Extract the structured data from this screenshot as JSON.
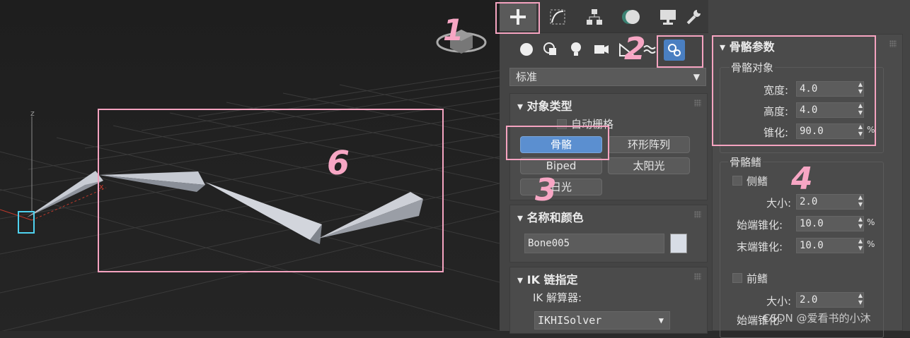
{
  "viewport": {
    "axis_z": "z",
    "axis_x": "x"
  },
  "tabs": [
    {
      "name": "create",
      "icon": "plus-icon"
    },
    {
      "name": "modify",
      "icon": "modify-curve-icon"
    },
    {
      "name": "hierarchy",
      "icon": "hierarchy-icon"
    },
    {
      "name": "motion",
      "icon": "motion-icon"
    },
    {
      "name": "display",
      "icon": "display-icon"
    },
    {
      "name": "utilities",
      "icon": "wrench-icon"
    }
  ],
  "tools": [
    "geometry-icon",
    "shapes-icon",
    "lights-icon",
    "cameras-icon",
    "helpers-icon",
    "spacewarps-icon",
    "systems-icon"
  ],
  "dropdown": {
    "value": "标准"
  },
  "object_type": {
    "title": "对象类型",
    "autogrid": "自动栅格",
    "buttons": [
      "骨骼",
      "环形阵列",
      "Biped",
      "太阳光",
      "日光"
    ]
  },
  "name_color": {
    "title": "名称和颜色",
    "name_value": "Bone005",
    "swatch": "#d8dde6"
  },
  "ik": {
    "title": "IK 链指定",
    "solver_label": "IK 解算器:",
    "solver_value": "IKHISolver"
  },
  "bone_params": {
    "title": "骨骼参数",
    "object_group": "骨骼对象",
    "width_label": "宽度:",
    "width": "4.0",
    "height_label": "高度:",
    "height": "4.0",
    "taper_label": "锥化:",
    "taper": "90.0",
    "fins_group": "骨骼鳍",
    "side_fins": "侧鳍",
    "size_label": "大小:",
    "side_size": "2.0",
    "start_taper_label": "始端锥化:",
    "side_start": "10.0",
    "end_taper_label": "末端锥化:",
    "side_end": "10.0",
    "front_fins": "前鳍",
    "front_size": "2.0",
    "front_start_label": "始端锥化:"
  },
  "percent": "%",
  "annotations": [
    "1",
    "2",
    "3",
    "4",
    "6"
  ],
  "watermark": "CSDN @爱看书的小沐"
}
